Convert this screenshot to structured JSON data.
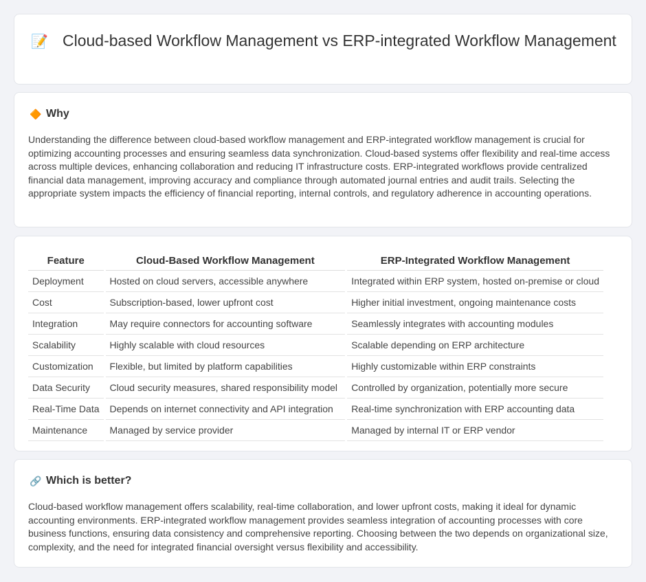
{
  "header": {
    "title_icon": "memo-icon",
    "title": "Cloud-based Workflow Management vs ERP-integrated Workflow Management"
  },
  "why": {
    "icon": "diamond-sign-icon",
    "heading": "Why",
    "body": "Understanding the difference between cloud-based workflow management and ERP-integrated workflow management is crucial for optimizing accounting processes and ensuring seamless data synchronization. Cloud-based systems offer flexibility and real-time access across multiple devices, enhancing collaboration and reducing IT infrastructure costs. ERP-integrated workflows provide centralized financial data management, improving accuracy and compliance through automated journal entries and audit trails. Selecting the appropriate system impacts the efficiency of financial reporting, internal controls, and regulatory adherence in accounting operations."
  },
  "comparison": {
    "headers": [
      "Feature",
      "Cloud-Based Workflow Management",
      "ERP-Integrated Workflow Management"
    ],
    "rows": [
      [
        "Deployment",
        "Hosted on cloud servers, accessible anywhere",
        "Integrated within ERP system, hosted on-premise or cloud"
      ],
      [
        "Cost",
        "Subscription-based, lower upfront cost",
        "Higher initial investment, ongoing maintenance costs"
      ],
      [
        "Integration",
        "May require connectors for accounting software",
        "Seamlessly integrates with accounting modules"
      ],
      [
        "Scalability",
        "Highly scalable with cloud resources",
        "Scalable depending on ERP architecture"
      ],
      [
        "Customization",
        "Flexible, but limited by platform capabilities",
        "Highly customizable within ERP constraints"
      ],
      [
        "Data Security",
        "Cloud security measures, shared responsibility model",
        "Controlled by organization, potentially more secure"
      ],
      [
        "Real-Time Data",
        "Depends on internet connectivity and API integration",
        "Real-time synchronization with ERP accounting data"
      ],
      [
        "Maintenance",
        "Managed by service provider",
        "Managed by internal IT or ERP vendor"
      ]
    ]
  },
  "better": {
    "icon": "link-icon",
    "heading": "Which is better?",
    "body": "Cloud-based workflow management offers scalability, real-time collaboration, and lower upfront costs, making it ideal for dynamic accounting environments. ERP-integrated workflow management provides seamless integration of accounting processes with core business functions, ensuring data consistency and comprehensive reporting. Choosing between the two depends on organizational size, complexity, and the need for integrated financial oversight versus flexibility and accessibility."
  }
}
